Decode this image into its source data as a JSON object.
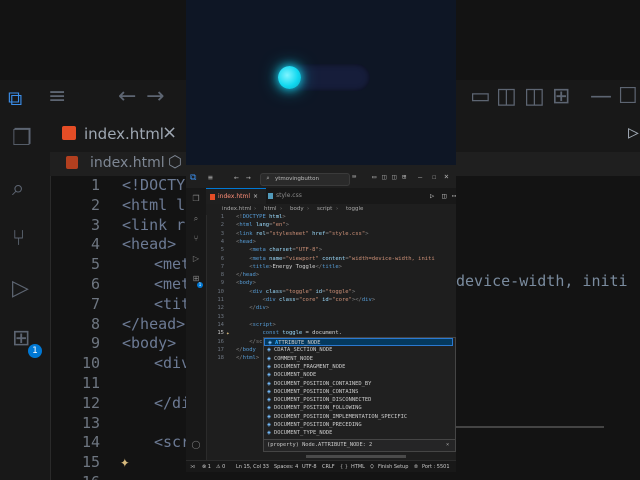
{
  "background_editor": {
    "tab_label": "index.html",
    "breadcrumb_file": "index.html",
    "line_numbers": [
      "1",
      "2",
      "3",
      "4",
      "5",
      "6",
      "7",
      "8",
      "9",
      "10",
      "11",
      "12",
      "13",
      "14",
      "15",
      "16"
    ],
    "visible_code": [
      "<!DOCTYPE",
      "<html la",
      "<link re",
      "<head>",
      "<met",
      "<met",
      "<tit",
      "</head>",
      "<body>",
      "<div",
      "",
      "</di",
      "",
      "<scr",
      "",
      ""
    ],
    "right_overflow": "device-width, initi",
    "extensions_badge": "1"
  },
  "preview": {
    "toggle_state": "on",
    "accent": "#12d9f2"
  },
  "editor": {
    "search_placeholder": "ytmovingbutton",
    "tabs": [
      {
        "label": "index.html",
        "active": true,
        "close": "×"
      },
      {
        "label": "style.css",
        "active": false
      }
    ],
    "breadcrumbs": [
      "index.html",
      "html",
      "body",
      "script",
      "toggle"
    ],
    "line_numbers": [
      "1",
      "2",
      "3",
      "4",
      "5",
      "6",
      "7",
      "8",
      "9",
      "10",
      "11",
      "12",
      "13",
      "14",
      "15",
      "16",
      "17",
      "18"
    ],
    "code": [
      {
        "parts": [
          [
            "br",
            "<!"
          ],
          [
            "tg",
            "DOCTYPE"
          ],
          [
            "at",
            " html"
          ],
          [
            "br",
            ">"
          ]
        ]
      },
      {
        "parts": [
          [
            "br",
            "<"
          ],
          [
            "tg",
            "html"
          ],
          [
            "at",
            " lang"
          ],
          [
            "br",
            "="
          ],
          [
            "st",
            "\"en\""
          ],
          [
            "br",
            ">"
          ]
        ]
      },
      {
        "parts": [
          [
            "br",
            "<"
          ],
          [
            "tg",
            "link"
          ],
          [
            "at",
            " rel"
          ],
          [
            "br",
            "="
          ],
          [
            "st",
            "\"stylesheet\""
          ],
          [
            "at",
            " href"
          ],
          [
            "br",
            "="
          ],
          [
            "st",
            "\"style.css\""
          ],
          [
            "br",
            ">"
          ]
        ]
      },
      {
        "parts": [
          [
            "br",
            "<"
          ],
          [
            "tg",
            "head"
          ],
          [
            "br",
            ">"
          ]
        ]
      },
      {
        "parts": [
          [
            "",
            "    "
          ],
          [
            "br",
            "<"
          ],
          [
            "tg",
            "meta"
          ],
          [
            "at",
            " charset"
          ],
          [
            "br",
            "="
          ],
          [
            "st",
            "\"UTF-8\""
          ],
          [
            "br",
            ">"
          ]
        ]
      },
      {
        "parts": [
          [
            "",
            "    "
          ],
          [
            "br",
            "<"
          ],
          [
            "tg",
            "meta"
          ],
          [
            "at",
            " name"
          ],
          [
            "br",
            "="
          ],
          [
            "st",
            "\"viewport\""
          ],
          [
            "at",
            " content"
          ],
          [
            "br",
            "="
          ],
          [
            "st",
            "\"width=device-width, initi"
          ]
        ]
      },
      {
        "parts": [
          [
            "",
            "    "
          ],
          [
            "br",
            "<"
          ],
          [
            "tg",
            "title"
          ],
          [
            "br",
            ">"
          ],
          [
            "",
            "Energy Toggle"
          ],
          [
            "br",
            "</"
          ],
          [
            "tg",
            "title"
          ],
          [
            "br",
            ">"
          ]
        ]
      },
      {
        "parts": [
          [
            "br",
            "</"
          ],
          [
            "tg",
            "head"
          ],
          [
            "br",
            ">"
          ]
        ]
      },
      {
        "parts": [
          [
            "br",
            "<"
          ],
          [
            "tg",
            "body"
          ],
          [
            "br",
            ">"
          ]
        ]
      },
      {
        "parts": [
          [
            "",
            "    "
          ],
          [
            "br",
            "<"
          ],
          [
            "tg",
            "div"
          ],
          [
            "at",
            " class"
          ],
          [
            "br",
            "="
          ],
          [
            "st",
            "\"toggle\""
          ],
          [
            "at",
            " id"
          ],
          [
            "br",
            "="
          ],
          [
            "st",
            "\"toggle\""
          ],
          [
            "br",
            ">"
          ]
        ]
      },
      {
        "parts": [
          [
            "",
            "        "
          ],
          [
            "br",
            "<"
          ],
          [
            "tg",
            "div"
          ],
          [
            "at",
            " class"
          ],
          [
            "br",
            "="
          ],
          [
            "st",
            "\"core\""
          ],
          [
            "at",
            " id"
          ],
          [
            "br",
            "="
          ],
          [
            "st",
            "\"core\""
          ],
          [
            "br",
            "></"
          ],
          [
            "tg",
            "div"
          ],
          [
            "br",
            ">"
          ]
        ]
      },
      {
        "parts": [
          [
            "",
            "    "
          ],
          [
            "br",
            "</"
          ],
          [
            "tg",
            "div"
          ],
          [
            "br",
            ">"
          ]
        ]
      },
      {
        "parts": [
          [
            "",
            ""
          ]
        ]
      },
      {
        "parts": [
          [
            "",
            "    "
          ],
          [
            "br",
            "<"
          ],
          [
            "tg",
            "script"
          ],
          [
            "br",
            ">"
          ]
        ]
      },
      {
        "parts": [
          [
            "",
            "        "
          ],
          [
            "kw",
            "const"
          ],
          [
            "vr",
            " toggle"
          ],
          [
            "",
            " = document."
          ]
        ]
      },
      {
        "parts": [
          [
            "",
            "    "
          ],
          [
            "br",
            "</sc"
          ]
        ]
      },
      {
        "parts": [
          [
            "br",
            "</"
          ],
          [
            "tg",
            "body"
          ]
        ]
      },
      {
        "parts": [
          [
            "br",
            "</"
          ],
          [
            "tg",
            "html"
          ],
          [
            "br",
            ">"
          ]
        ]
      }
    ],
    "suggestions": [
      {
        "highlight": "A",
        "rest": "TTRIBUTE_NODE",
        "selected": true
      },
      {
        "highlight": "",
        "rest": "CDATA_SECTION_NODE",
        "selected": false
      },
      {
        "highlight": "",
        "rest": "COMMENT_NODE",
        "selected": false
      },
      {
        "highlight": "",
        "rest": "DOCUMENT_FRAGMENT_NODE",
        "selected": false
      },
      {
        "highlight": "",
        "rest": "DOCUMENT_NODE",
        "selected": false
      },
      {
        "highlight": "",
        "rest": "DOCUMENT_POSITION_CONTAINED_BY",
        "selected": false
      },
      {
        "highlight": "",
        "rest": "DOCUMENT_POSITION_CONTAINS",
        "selected": false
      },
      {
        "highlight": "",
        "rest": "DOCUMENT_POSITION_DISCONNECTED",
        "selected": false
      },
      {
        "highlight": "",
        "rest": "DOCUMENT_POSITION_FOLLOWING",
        "selected": false
      },
      {
        "highlight": "",
        "rest": "DOCUMENT_POSITION_IMPLEMENTATION_SPECIFIC",
        "selected": false
      },
      {
        "highlight": "",
        "rest": "DOCUMENT_POSITION_PRECEDING",
        "selected": false
      },
      {
        "highlight": "",
        "rest": "DOCUMENT_TYPE_NODE",
        "selected": false
      }
    ],
    "detail": "(property) Node.ATTRIBUTE_NODE: 2",
    "status": {
      "errors": "⊗ 1",
      "warnings": "⚠ 0",
      "position": "Ln 15, Col 33",
      "spaces": "Spaces: 4",
      "encoding": "UTF-8",
      "eol": "CRLF",
      "language": "HTML",
      "finish_setup": "Finish Setup",
      "port": "Port : 5501"
    },
    "extensions_badge": "1"
  }
}
